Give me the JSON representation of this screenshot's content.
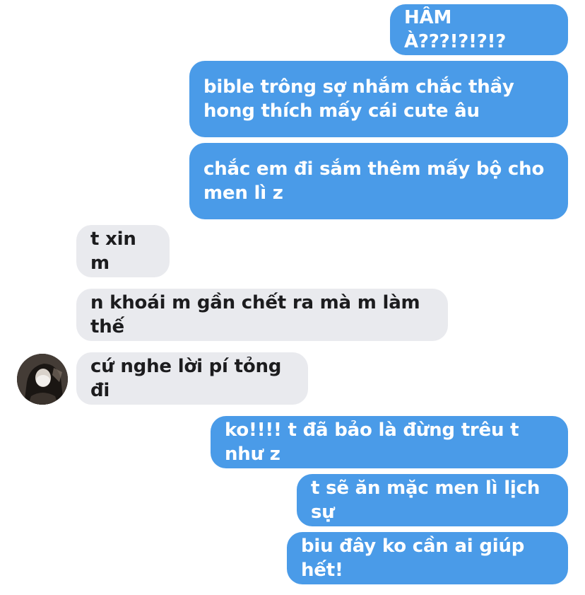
{
  "colors": {
    "outgoing_bubble": "#4a9be8",
    "incoming_bubble": "#e9eaee",
    "outgoing_text": "#ffffff",
    "incoming_text": "#1c1c1e"
  },
  "messages": [
    {
      "direction": "outgoing",
      "text": "HÂM À???!?!?!?"
    },
    {
      "direction": "outgoing",
      "text": "bible trông sợ nhắm chắc thầy hong thích mấy cái cute âu"
    },
    {
      "direction": "outgoing",
      "text": "chắc em đi sắm thêm mấy bộ cho men lì z"
    },
    {
      "direction": "incoming",
      "text": "t xin m"
    },
    {
      "direction": "incoming",
      "text": "n khoái m gần chết ra mà m làm thế"
    },
    {
      "direction": "incoming",
      "text": "cứ nghe lời pí tỏng đi"
    },
    {
      "direction": "outgoing",
      "text": "ko!!!! t đã bảo là đừng trêu t như z"
    },
    {
      "direction": "outgoing",
      "text": "t sẽ ăn mặc men lì lịch sự"
    },
    {
      "direction": "outgoing",
      "text": "biu đây ko cần ai giúp hết!"
    }
  ],
  "avatar": {
    "icon": "contact-avatar-photo"
  }
}
